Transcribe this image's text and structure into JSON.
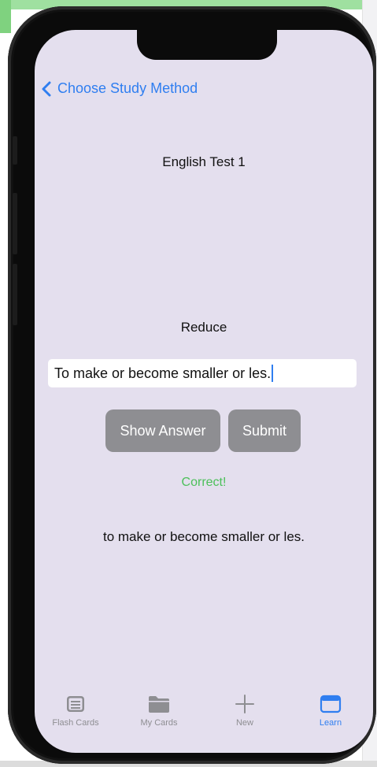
{
  "nav": {
    "back_label": "Choose Study Method"
  },
  "deck": {
    "title": "English Test 1"
  },
  "card": {
    "term": "Reduce",
    "answer_input_value": "To make or become smaller or les.",
    "status_text": "Correct!",
    "correct_answer": "to make or become smaller or les."
  },
  "buttons": {
    "show_answer": "Show Answer",
    "submit": "Submit"
  },
  "tabs": [
    {
      "label": "Flash Cards",
      "icon": "flash-cards-icon"
    },
    {
      "label": "My Cards",
      "icon": "folder-icon"
    },
    {
      "label": "New",
      "icon": "plus-icon"
    },
    {
      "label": "Learn",
      "icon": "learn-window-icon",
      "selected": true
    }
  ],
  "colors": {
    "screen_bg": "#e4dfee",
    "accent": "#2f7ef0",
    "button_gray": "#8e8e92",
    "success": "#4cc05a"
  }
}
